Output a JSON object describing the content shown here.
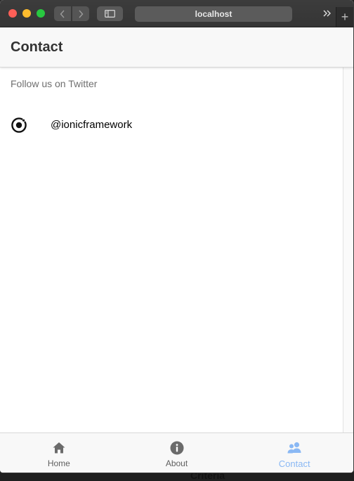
{
  "browser": {
    "url": "localhost",
    "more_icon": "double-chevron-right-icon",
    "new_tab_symbol": "+"
  },
  "header": {
    "title": "Contact"
  },
  "content": {
    "list_header": "Follow us on Twitter",
    "items": [
      {
        "icon": "ionic-logo-icon",
        "label": "@ionicframework"
      }
    ]
  },
  "tabs": [
    {
      "label": "Home",
      "icon": "home-icon",
      "selected": false
    },
    {
      "label": "About",
      "icon": "info-icon",
      "selected": false
    },
    {
      "label": "Contact",
      "icon": "people-icon",
      "selected": true
    }
  ],
  "underlay": {
    "text": "Criteria"
  },
  "colors": {
    "accent": "#8ab8f4",
    "tab_inactive": "#5f5f5f",
    "header_bg": "#f8f8f8"
  }
}
